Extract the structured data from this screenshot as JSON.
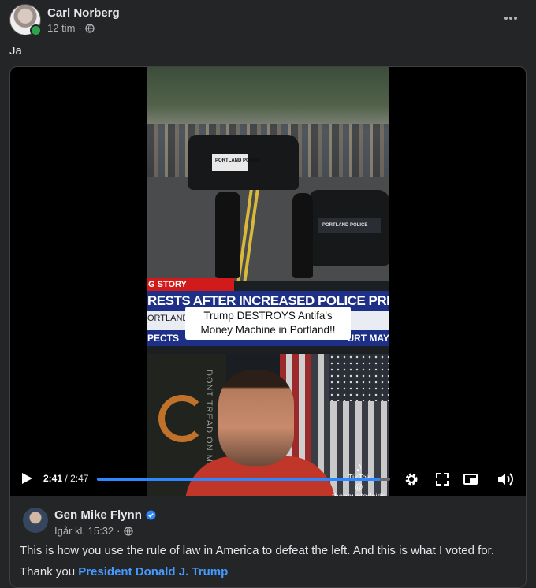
{
  "post": {
    "author": "Carl Norberg",
    "timestamp": "12 tim",
    "separator": "·",
    "audience_icon": "globe-icon",
    "menu_icon": "more-options-icon",
    "text": "Ja"
  },
  "video": {
    "story_tag": "G STORY",
    "headline": "RESTS AFTER INCREASED POLICE PRESENC",
    "lower_left_1": "ORTLAND",
    "lower_left_2": "PECTS",
    "lower_right_2": "URT MAY",
    "caption_line1": "Trump DESTROYS Antifa's",
    "caption_line2": "Money Machine in Portland!!",
    "car_label_1": "PORTLAND  POLICE",
    "car_label_2": "PORTLAND      POLICE",
    "flag_text": "DONT TREAD ON ME",
    "watermark_brand": "TikTok",
    "watermark_handle": "@ thehauntedside",
    "current_time": "2:41",
    "time_separator": "/",
    "total_time": "2:47",
    "progress_fraction": 0.964,
    "accent_color": "#2d88ff"
  },
  "shared": {
    "author": "Gen Mike Flynn",
    "verified_icon": "verified-badge-icon",
    "timestamp": "Igår kl. 15:32",
    "separator": "·",
    "text_line1": "This is how you use the rule of law in America to defeat the left. And this is what I voted for.",
    "text_line2_prefix": "Thank you ",
    "mention": "President Donald J. Trump",
    "mention_color": "#4599ff"
  }
}
